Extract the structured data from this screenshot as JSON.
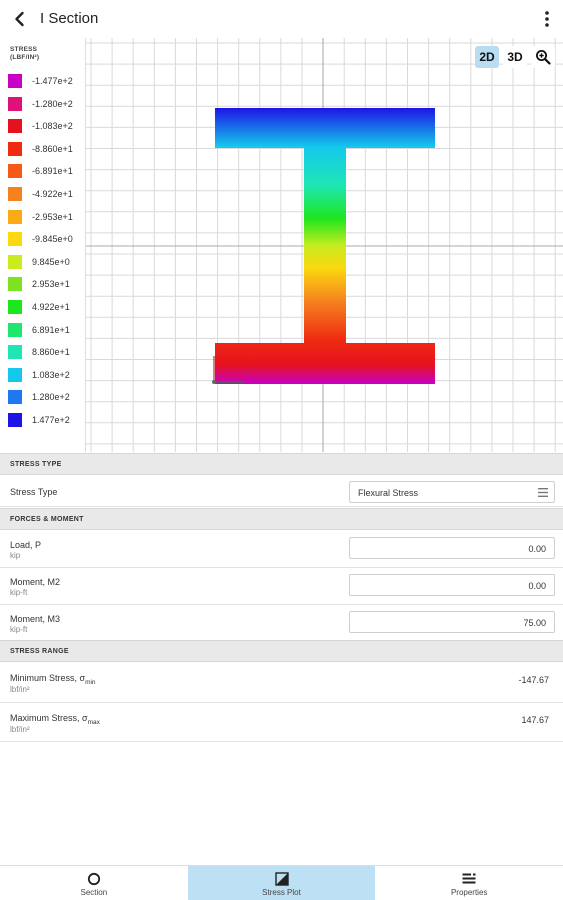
{
  "header": {
    "title": "I Section"
  },
  "plot": {
    "legend_title_line1": "STRESS",
    "legend_title_line2": "(LBF/IN²)",
    "legend": [
      {
        "label": "-1.477e+2",
        "color": "#c800c8"
      },
      {
        "label": "-1.280e+2",
        "color": "#e0127a"
      },
      {
        "label": "-1.083e+2",
        "color": "#e5121e"
      },
      {
        "label": "-8.860e+1",
        "color": "#ef2b12"
      },
      {
        "label": "-6.891e+1",
        "color": "#f55a16"
      },
      {
        "label": "-4.922e+1",
        "color": "#f5821e"
      },
      {
        "label": "-2.953e+1",
        "color": "#f9aa14"
      },
      {
        "label": "-9.845e+0",
        "color": "#fbd80f"
      },
      {
        "label": "9.845e+0",
        "color": "#c8ec1e"
      },
      {
        "label": "2.953e+1",
        "color": "#7ce31e"
      },
      {
        "label": "4.922e+1",
        "color": "#1ee61e"
      },
      {
        "label": "6.891e+1",
        "color": "#1ee66e"
      },
      {
        "label": "8.860e+1",
        "color": "#1ee6b4"
      },
      {
        "label": "1.083e+2",
        "color": "#14c8ec"
      },
      {
        "label": "1.280e+2",
        "color": "#1e78f0"
      },
      {
        "label": "1.477e+2",
        "color": "#1e14e6"
      }
    ],
    "view_buttons": {
      "btn_2d": "2D",
      "btn_3d": "3D"
    },
    "active_view": "2D"
  },
  "stress_type": {
    "header": "STRESS TYPE",
    "label": "Stress Type",
    "value": "Flexural Stress"
  },
  "forces": {
    "header": "FORCES & MOMENT",
    "items": [
      {
        "label": "Load, P",
        "unit": "kip",
        "value": "0.00"
      },
      {
        "label": "Moment, M2",
        "unit": "kip-ft",
        "value": "0.00"
      },
      {
        "label": "Moment, M3",
        "unit": "kip-ft",
        "value": "75.00"
      }
    ]
  },
  "stress_range": {
    "header": "STRESS RANGE",
    "min": {
      "label": "Minimum Stress, σ",
      "sub": "min",
      "unit": "lbf/in²",
      "value": "-147.67"
    },
    "max": {
      "label": "Maximum Stress, σ",
      "sub": "max",
      "unit": "lbf/in²",
      "value": "147.67"
    }
  },
  "bottom_nav": {
    "tabs": [
      {
        "label": "Section",
        "icon": "circle-icon"
      },
      {
        "label": "Stress Plot",
        "icon": "stress-plot-icon"
      },
      {
        "label": "Properties",
        "icon": "properties-icon"
      }
    ],
    "active": "Stress Plot"
  }
}
